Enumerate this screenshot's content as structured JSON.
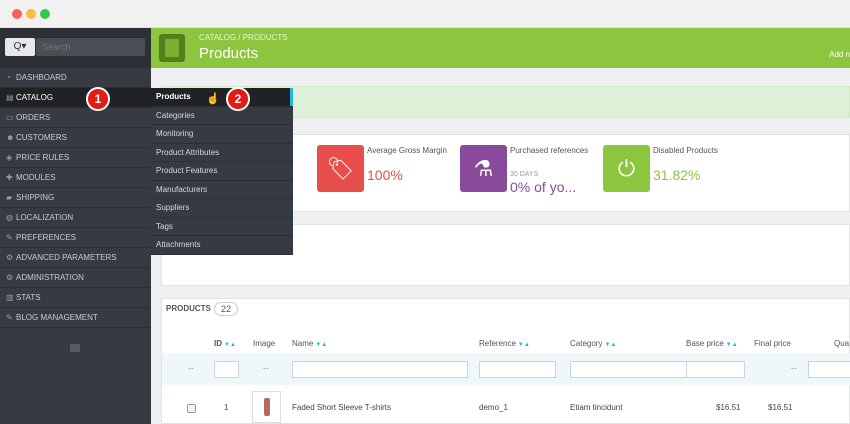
{
  "colors": {
    "accent_green": "#8cc63f",
    "sidebar": "#363a41",
    "callout": "#e31b12",
    "sort_arrow": "#25b9d7"
  },
  "sidebar": {
    "search_button_label": "Q▾",
    "search_placeholder": "Search",
    "items": [
      {
        "label": "DASHBOARD",
        "icon": "dashboard-icon",
        "glyph": "◔"
      },
      {
        "label": "CATALOG",
        "icon": "book-icon",
        "glyph": "▤"
      },
      {
        "label": "ORDERS",
        "icon": "credit-card-icon",
        "glyph": "▭"
      },
      {
        "label": "CUSTOMERS",
        "icon": "users-icon",
        "glyph": "☻"
      },
      {
        "label": "PRICE RULES",
        "icon": "tag-icon",
        "glyph": "◈"
      },
      {
        "label": "MODULES",
        "icon": "puzzle-icon",
        "glyph": "✚"
      },
      {
        "label": "SHIPPING",
        "icon": "truck-icon",
        "glyph": "▰"
      },
      {
        "label": "LOCALIZATION",
        "icon": "globe-icon",
        "glyph": "◍"
      },
      {
        "label": "PREFERENCES",
        "icon": "wrench-icon",
        "glyph": "✎"
      },
      {
        "label": "ADVANCED PARAMETERS",
        "icon": "cogs-icon",
        "glyph": "⚙"
      },
      {
        "label": "ADMINISTRATION",
        "icon": "gear-icon",
        "glyph": "⚙"
      },
      {
        "label": "STATS",
        "icon": "bar-chart-icon",
        "glyph": "▥"
      },
      {
        "label": "BLOG MANAGEMENT",
        "icon": "pencil-icon",
        "glyph": "✎"
      }
    ]
  },
  "catalog_submenu": [
    "Products",
    "Categories",
    "Monitoring",
    "Product Attributes",
    "Product Features",
    "Manufacturers",
    "Suppliers",
    "Tags",
    "Attachments"
  ],
  "callouts": {
    "first": "1",
    "second": "2"
  },
  "header": {
    "breadcrumb": "CATALOG  /  PRODUCTS",
    "title": "Products",
    "add_label": "Add n"
  },
  "kpis": [
    {
      "label": "Average Gross Margin",
      "sub": "",
      "value": "100%",
      "color": "#e84e4b",
      "value_color": "#e84e4b",
      "icon": "tag-icon",
      "glyph": "🏷"
    },
    {
      "label": "Purchased references",
      "sub": "30 DAYS",
      "value": "0% of yo...",
      "color": "#8a4a9c",
      "value_color": "#8a4a9c",
      "icon": "flask-icon",
      "glyph": "⚗"
    },
    {
      "label": "Disabled Products",
      "sub": "",
      "value": "31.82%",
      "color": "#8cc63f",
      "value_color": "#8cc63f",
      "icon": "power-icon",
      "glyph": "⏻"
    }
  ],
  "products_panel": {
    "title": "PRODUCTS",
    "count": "22",
    "columns": [
      "ID",
      "Image",
      "Name",
      "Reference",
      "Category",
      "Base price",
      "Final price",
      "Qua"
    ],
    "filter_dash": "--",
    "row": {
      "id": "1",
      "name": "Faded Short Sleeve T-shirts",
      "reference": "demo_1",
      "category": "Etiam tincidunt",
      "base_price": "$16.51",
      "final_price": "$16.51"
    }
  }
}
